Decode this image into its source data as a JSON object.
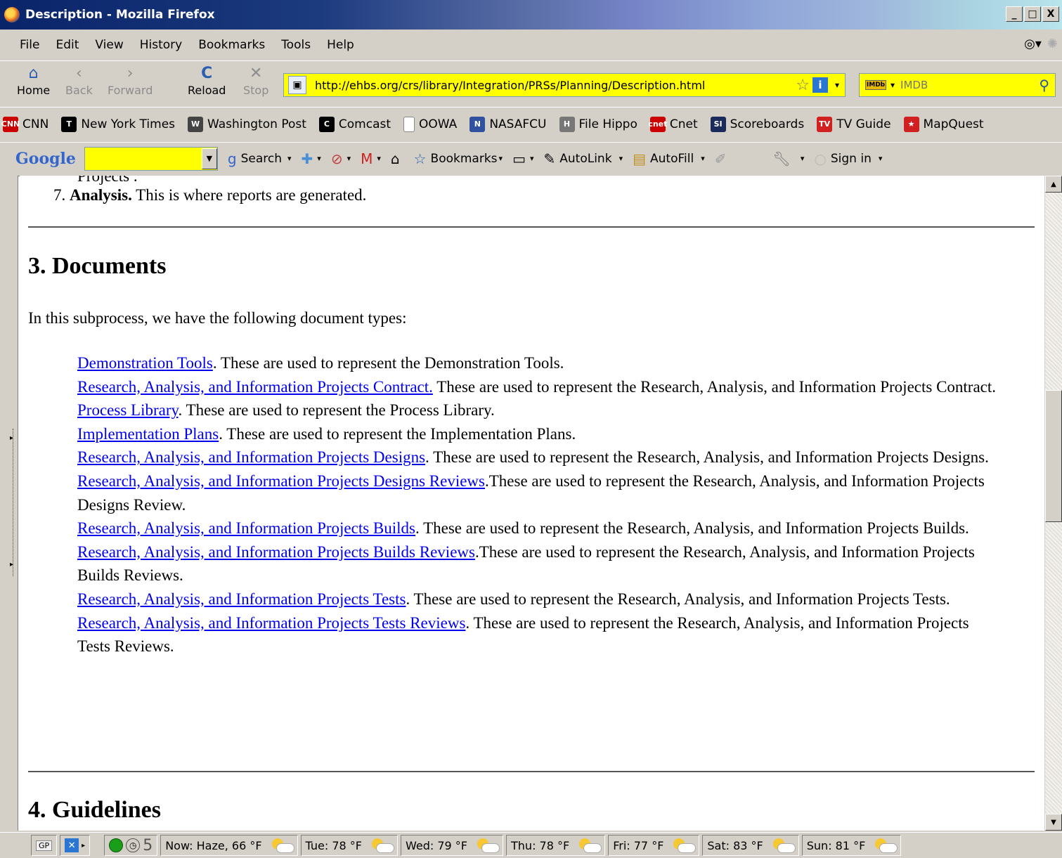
{
  "window": {
    "title": "Description - Mozilla Firefox",
    "minimize": "_",
    "maximize": "□",
    "close": "X"
  },
  "menu": [
    "File",
    "Edit",
    "View",
    "History",
    "Bookmarks",
    "Tools",
    "Help"
  ],
  "nav": {
    "home": "Home",
    "back": "Back",
    "forward": "Forward",
    "reload": "Reload",
    "stop": "Stop",
    "url": "http://ehbs.org/crs/library/Integration/PRSs/Planning/Description.html",
    "search_placeholder": "IMDB"
  },
  "bookmarks": [
    {
      "label": "CNN",
      "icon": "cnn-icon",
      "badge": "CNN",
      "color": "#cc0000"
    },
    {
      "label": "New York Times",
      "icon": "nyt-icon",
      "badge": "T",
      "color": "#000000"
    },
    {
      "label": "Washington Post",
      "icon": "wapo-icon",
      "badge": "W",
      "color": "#444444"
    },
    {
      "label": "Comcast",
      "icon": "comcast-icon",
      "badge": "C",
      "color": "#000000"
    },
    {
      "label": "OOWA",
      "icon": "page-icon",
      "badge": "",
      "color": "#ffffff"
    },
    {
      "label": "NASAFCU",
      "icon": "nasa-icon",
      "badge": "N",
      "color": "#3050a0"
    },
    {
      "label": "File Hippo",
      "icon": "hippo-icon",
      "badge": "H",
      "color": "#777777"
    },
    {
      "label": "Cnet",
      "icon": "cnet-icon",
      "badge": "cnet",
      "color": "#cc0000"
    },
    {
      "label": "Scoreboards",
      "icon": "si-icon",
      "badge": "SI",
      "color": "#1a2a5a"
    },
    {
      "label": "TV Guide",
      "icon": "tvguide-icon",
      "badge": "TV",
      "color": "#d02020"
    },
    {
      "label": "MapQuest",
      "icon": "mapquest-icon",
      "badge": "★",
      "color": "#d02020"
    }
  ],
  "google_toolbar": {
    "logo": "Google",
    "search": "Search",
    "bookmarks": "Bookmarks",
    "autolink": "AutoLink",
    "autofill": "AutoFill",
    "signin": "Sign in"
  },
  "page": {
    "cut_line": "Projects .",
    "item7_num": "7.",
    "item7_bold": "Analysis.",
    "item7_text": " This is where reports are generated.",
    "section3_title": "3. Documents",
    "intro": "In this subprocess, we have the following document types:",
    "documents": [
      {
        "link": "Demonstration Tools",
        "text": ". These are used to represent the Demonstration Tools."
      },
      {
        "link": "Research, Analysis, and Information Projects Contract.",
        "text": " These are used to represent the Research, Analysis, and Information Projects Contract."
      },
      {
        "link": "Process Library",
        "text": ". These are used to represent the Process Library."
      },
      {
        "link": "Implementation Plans",
        "text": ". These are used to represent the Implementation Plans."
      },
      {
        "link": "Research, Analysis, and Information Projects Designs",
        "text": ". These are used to represent the Research, Analysis, and Information Projects Designs."
      },
      {
        "link": "Research, Analysis, and Information Projects Designs Reviews",
        "text": ".These are used to represent the Research, Analysis, and Information Projects Designs Review."
      },
      {
        "link": "Research, Analysis, and Information Projects Builds",
        "text": ". These are used to represent the Research, Analysis, and Information Projects Builds."
      },
      {
        "link": "Research, Analysis, and Information Projects Builds Reviews",
        "text": ".These are used to represent the Research, Analysis, and Information Projects Builds Reviews."
      },
      {
        "link": "Research, Analysis, and Information Projects Tests",
        "text": ". These are used to represent the Research, Analysis, and Information Projects Tests."
      },
      {
        "link": "Research, Analysis, and Information Projects Tests Reviews",
        "text": ". These are used to represent the Research, Analysis, and Information Projects Tests Reviews."
      }
    ],
    "section4_title": "4. Guidelines"
  },
  "status": {
    "gp": "GP",
    "counter": "5",
    "weather": [
      {
        "label": "Now: Haze, 66 °F"
      },
      {
        "label": "Tue: 78 °F"
      },
      {
        "label": "Wed: 79 °F"
      },
      {
        "label": "Thu: 78 °F"
      },
      {
        "label": "Fri: 77 °F"
      },
      {
        "label": "Sat: 83 °F"
      },
      {
        "label": "Sun: 81 °F"
      }
    ]
  }
}
